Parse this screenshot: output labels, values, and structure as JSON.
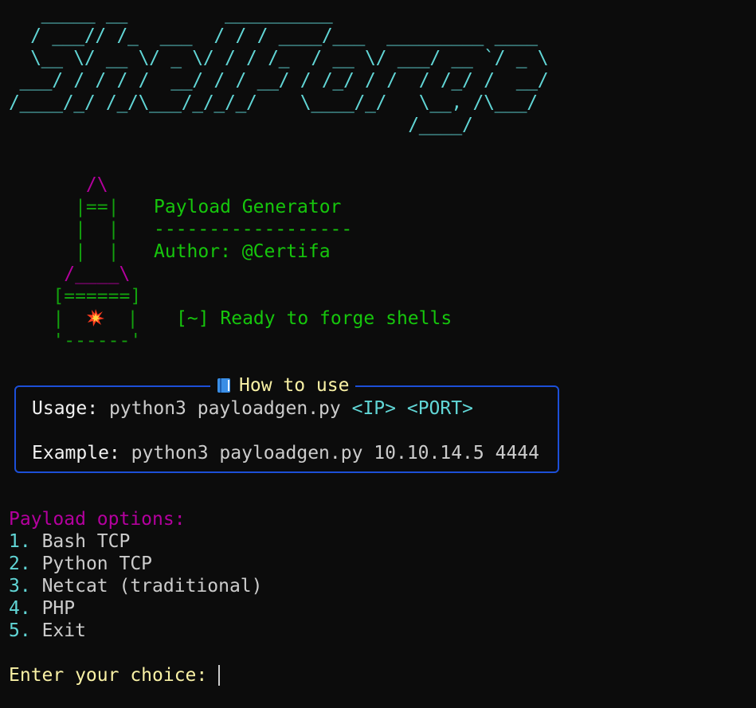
{
  "banner": {
    "ascii_art": "   _____ __         __________\n  / ___// /_  ___  / / / ____/___  _________ ____\n  \\__ \\/ __ \\/ _ \\/ / / /_  / __ \\/ ___/ __ `/ _ \\\n ___/ / / / /  __/ / / __/ / /_/ / /  / /_/ /  __/\n/____/_/ /_/\\___/_/_/_/    \\____/_/   \\__, /\\___/\n                                     /____/"
  },
  "rocket": {
    "line1": "       /\\",
    "line2": "      |==|",
    "line3": "      |  |",
    "line4": "      |  |",
    "line5": "     /____\\",
    "line6": "    [======]",
    "line7_left": "    |  ",
    "line7_right": "  |",
    "line8": "    '------'",
    "icon": "explosion-icon"
  },
  "info": {
    "title": "Payload Generator",
    "divider": "------------------",
    "author": "Author: @Certifa",
    "status": "[~] Ready to forge shells"
  },
  "panel": {
    "title": "How to use",
    "title_icon": "blue-book-icon",
    "usage_label": "Usage:",
    "usage_cmd": "python3 payloadgen.py",
    "usage_ip": "<IP>",
    "usage_port": "<PORT>",
    "example_label": "Example:",
    "example_cmd": "python3 payloadgen.py 10.10.14.5 4444",
    "border_color": "#1c4fd8"
  },
  "menu": {
    "heading": "Payload options:",
    "options": [
      {
        "num": "1.",
        "label": "Bash TCP"
      },
      {
        "num": "2.",
        "label": "Python TCP"
      },
      {
        "num": "3.",
        "label": "Netcat (traditional)"
      },
      {
        "num": "4.",
        "label": "PHP"
      },
      {
        "num": "5.",
        "label": "Exit"
      }
    ]
  },
  "prompt": {
    "text": "Enter your choice:",
    "value": ""
  },
  "colors": {
    "background": "#0c0c0c",
    "banner": "#61d6d6",
    "rocket_tip": "#b4009e",
    "rocket_body": "#13a10e",
    "info": "#16c60c",
    "heading": "#b4009e",
    "prompt": "#f9f1a5"
  }
}
